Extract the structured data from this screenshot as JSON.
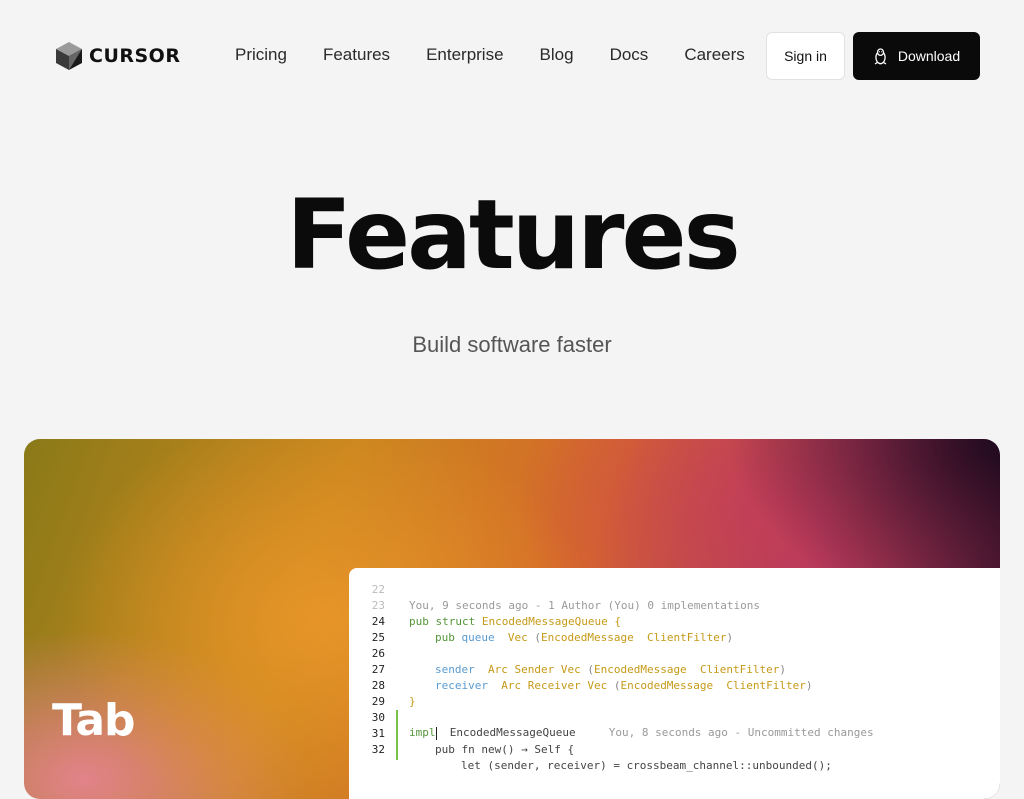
{
  "brand": {
    "name": "CURSOR"
  },
  "nav": {
    "links": [
      "Pricing",
      "Features",
      "Enterprise",
      "Blog",
      "Docs",
      "Careers"
    ],
    "sign_in": "Sign in",
    "download": "Download"
  },
  "hero": {
    "title": "Features",
    "subtitle": "Build software faster"
  },
  "feature": {
    "title": "Tab"
  },
  "editor": {
    "lines": [
      {
        "n": "22",
        "meta": ""
      },
      {
        "n": "23",
        "meta": "You, 9 seconds ago - 1 Author (You) 0 implementations"
      },
      {
        "n": "24",
        "kw": "pub struct",
        "type": "EncodedMessageQueue",
        "punc": "{"
      },
      {
        "n": "25",
        "kw": "pub",
        "field": "queue",
        "type": "Vec",
        "punc1": "(",
        "type2": "EncodedMessage",
        "type3": "ClientFilter",
        "punc2": ")"
      },
      {
        "n": "26"
      },
      {
        "n": "27",
        "field": "sender",
        "type": "Arc Sender Vec",
        "punc1": "(",
        "type2": "EncodedMessage",
        "type3": "ClientFilter",
        "punc2": ")"
      },
      {
        "n": "28",
        "field": "receiver",
        "type": "Arc Receiver Vec",
        "punc1": "(",
        "type2": "EncodedMessage",
        "type3": "ClientFilter",
        "punc2": ")"
      },
      {
        "n": "29",
        "punc": "}"
      },
      {
        "n": "30"
      },
      {
        "n": "31",
        "kw": "impl",
        "plain": "EncodedMessageQueue",
        "meta": "You, 8 seconds ago - Uncommitted changes"
      },
      {
        "n": "32",
        "plain": "pub fn new() → Self {"
      },
      {
        "n": "",
        "plain": "let (sender, receiver) = crossbeam_channel::unbounded();"
      }
    ]
  },
  "colors": {
    "background": "#f4f4f4",
    "download_button": "#0a0a0a",
    "keyword": "#55963a",
    "type": "#c59a18",
    "field": "#5a9bd0"
  },
  "icons": {
    "logo": "cursor-cube-icon",
    "download": "linux-penguin-icon"
  }
}
